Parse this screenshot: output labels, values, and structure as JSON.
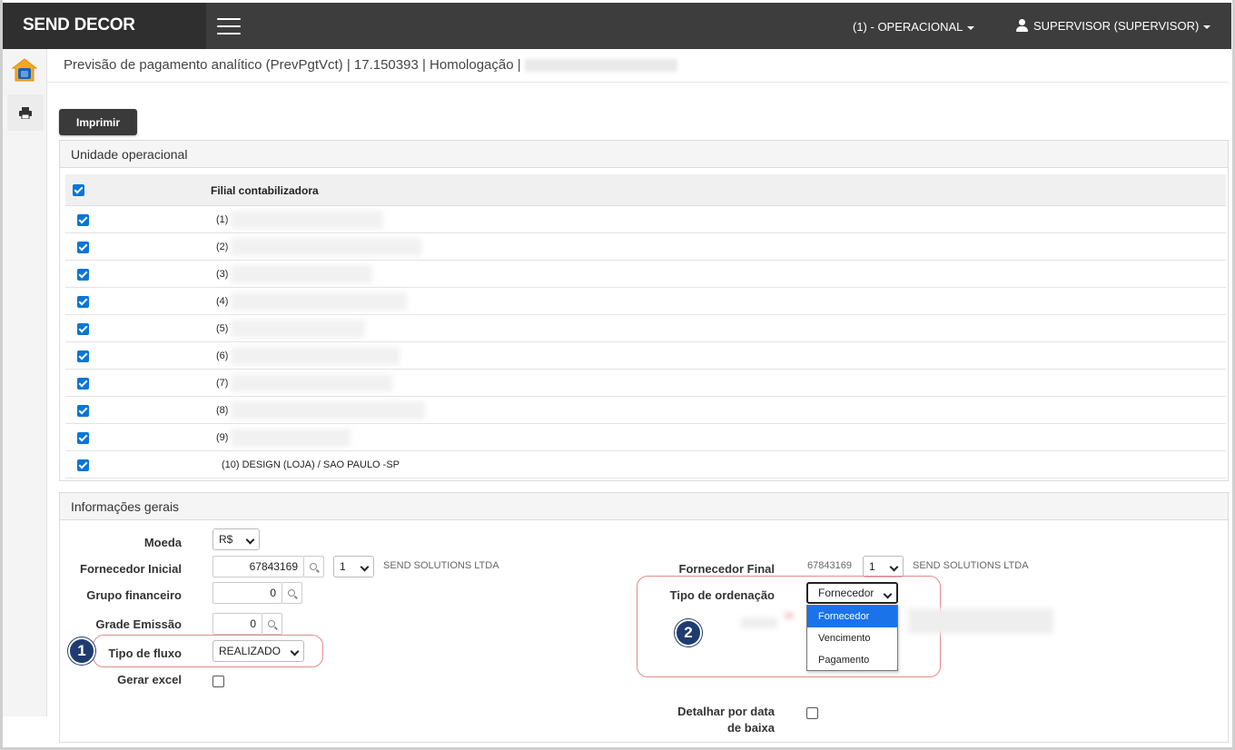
{
  "app": {
    "brand": "SEND DECOR",
    "operation": "(1) - OPERACIONAL",
    "user": "SUPERVISOR (SUPERVISOR)"
  },
  "page": {
    "title": "Previsão de pagamento analítico (PrevPgtVct) | 17.150393 | Homologação |"
  },
  "toolbar": {
    "print_label": "Imprimir"
  },
  "units_panel": {
    "title": "Unidade operacional",
    "column_header": "Filial contabilizadora",
    "rows": [
      {
        "label": "(1)",
        "checked": true
      },
      {
        "label": "(2)",
        "checked": true
      },
      {
        "label": "(3)",
        "checked": true
      },
      {
        "label": "(4)",
        "checked": true
      },
      {
        "label": "(5)",
        "checked": true
      },
      {
        "label": "(6)",
        "checked": true
      },
      {
        "label": "(7)",
        "checked": true
      },
      {
        "label": "(8)",
        "checked": true
      },
      {
        "label": "(9)",
        "checked": true
      },
      {
        "label": "(10) DESIGN (LOJA) / SAO PAULO -SP",
        "checked": true
      }
    ]
  },
  "general_panel": {
    "title": "Informações gerais",
    "moeda": {
      "label": "Moeda",
      "value": "R$"
    },
    "fornecedor_inicial": {
      "label": "Fornecedor Inicial",
      "code": "67843169",
      "seq": "1",
      "name": "SEND SOLUTIONS LTDA"
    },
    "fornecedor_final": {
      "label": "Fornecedor Final",
      "code": "67843169",
      "seq": "1",
      "name": "SEND SOLUTIONS LTDA"
    },
    "grupo_financeiro": {
      "label": "Grupo financeiro",
      "value": "0"
    },
    "grade_emissao": {
      "label": "Grade Emissão",
      "value": "0"
    },
    "tipo_fluxo": {
      "label": "Tipo de fluxo",
      "value": "REALIZADO"
    },
    "gerar_excel": {
      "label": "Gerar excel",
      "checked": false
    },
    "tipo_ordenacao": {
      "label": "Tipo de ordenação",
      "value": "Fornecedor",
      "options": [
        "Fornecedor",
        "Vencimento",
        "Pagamento"
      ]
    },
    "detalhar": {
      "label_line1": "Detalhar por data",
      "label_line2": "de baixa",
      "checked": false
    }
  },
  "annotations": {
    "marker1": "1",
    "marker2": "2",
    "highlight_color": "#e58a8a",
    "marker_color": "#1f3b6f"
  },
  "colors": {
    "topbar": "#3d3d3d",
    "brand_bg": "#2f2f2f",
    "checkbox_blue": "#0a75d5",
    "dropdown_active": "#1a73e8"
  }
}
